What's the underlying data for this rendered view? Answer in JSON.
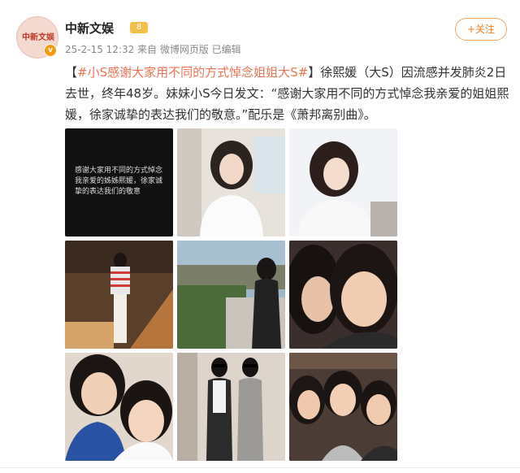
{
  "header": {
    "avatar_text": "中新文娱",
    "verified_badge": "v",
    "account_name": "中新文娱",
    "level_badge": "8",
    "meta": "25-2-15 12:32 来自 微博网页版 已编辑",
    "follow_label": "+关注"
  },
  "post": {
    "hashtag": "#小S感谢大家用不同的方式悼念姐姐大S#",
    "body": "徐熙媛（大S）因流感并发肺炎2日去世，终年48岁。妹妹小S今日发文：“感谢大家用不同的方式悼念我亲爱的姐姐熙媛，徐家诚挚的表达我们的敬意。”配乐是《萧邦离别曲》。"
  },
  "images": {
    "img1_caption": "感谢大家用不同的方式悼念我亲爱的姊姊熙媛，徐家诚挚的表达我们的敬意"
  },
  "colors": {
    "accent": "#eb7350",
    "follow": "#f37b1d"
  }
}
